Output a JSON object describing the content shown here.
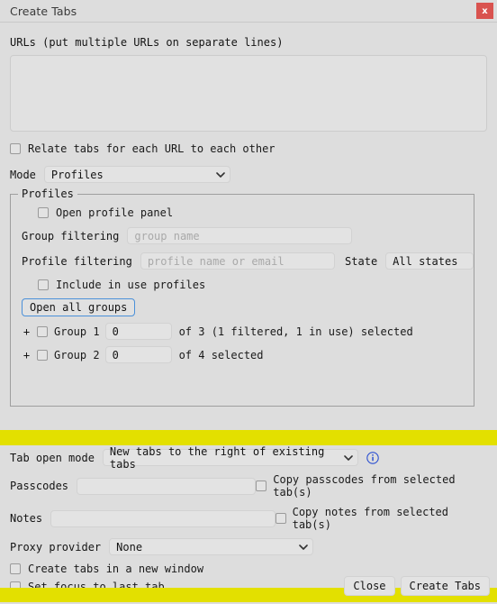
{
  "window": {
    "title": "Create Tabs",
    "close_label": "x"
  },
  "urls": {
    "label": "URLs (put multiple URLs on separate lines)",
    "value": ""
  },
  "relate": {
    "label": "Relate tabs for each URL to each other"
  },
  "mode": {
    "label": "Mode",
    "value": "Profiles"
  },
  "profiles": {
    "legend": "Profiles",
    "open_profile_panel": "Open profile panel",
    "group_filtering_label": "Group filtering",
    "group_filtering_placeholder": "group name",
    "group_filtering_value": "",
    "profile_filtering_label": "Profile filtering",
    "profile_filtering_placeholder": "profile name or email",
    "profile_filtering_value": "",
    "state_label": "State",
    "state_value": "All states",
    "include_in_use": "Include in use profiles",
    "open_all_groups": "Open all groups",
    "groups": [
      {
        "expander": "+",
        "name": "Group 1",
        "count": "0",
        "suffix": "of 3 (1 filtered, 1 in use) selected"
      },
      {
        "expander": "+",
        "name": "Group 2",
        "count": "0",
        "suffix": "of 4 selected"
      }
    ]
  },
  "tab_open_mode": {
    "label": "Tab open mode",
    "value": "New tabs to the right of existing tabs",
    "info_icon": "info-circle-icon"
  },
  "passcodes": {
    "label": "Passcodes",
    "value": "",
    "copy_label": "Copy passcodes from selected tab(s)"
  },
  "notes": {
    "label": "Notes",
    "value": "",
    "copy_label": "Copy notes from selected tab(s)"
  },
  "proxy": {
    "label": "Proxy provider",
    "value": "None"
  },
  "options": {
    "new_window": "Create tabs in a new window",
    "set_focus": "Set focus to last tab"
  },
  "footer": {
    "close": "Close",
    "create": "Create Tabs"
  },
  "colors": {
    "highlight": "#e3e000",
    "close_button": "#d9534f",
    "accent_blue": "#4a90d9"
  }
}
